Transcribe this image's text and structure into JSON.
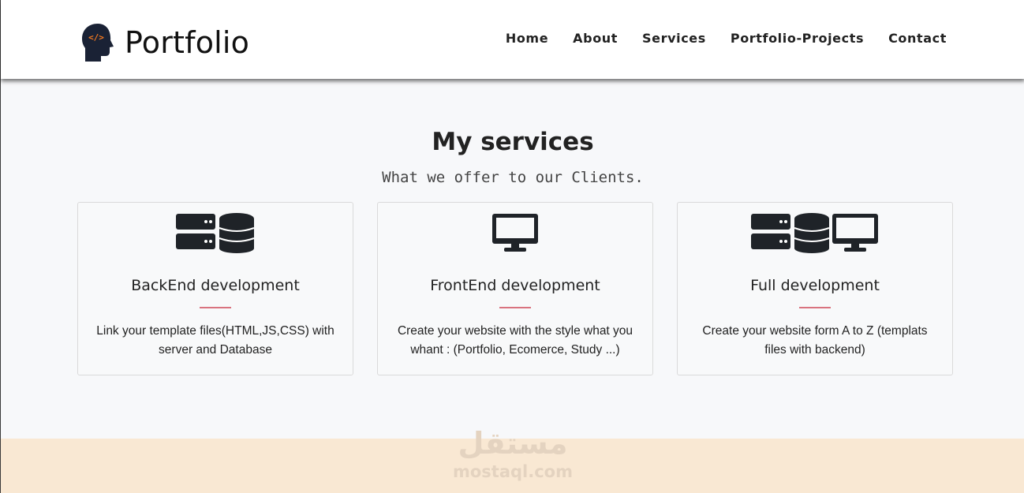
{
  "header": {
    "logo_icon": "head-code-icon",
    "title": "Portfolio",
    "nav": [
      "Home",
      "About",
      "Services",
      "Portfolio-Projects",
      "Contact"
    ]
  },
  "services": {
    "title": "My services",
    "subtitle": "What we offer to our Clients.",
    "cards": [
      {
        "icon": "server-database-icon",
        "title": "BackEnd development",
        "text": "Link your template files(HTML,JS,CSS) with server and Database"
      },
      {
        "icon": "desktop-icon",
        "title": "FrontEnd development",
        "text": "Create your website with the style what you whant : (Portfolio, Ecomerce, Study ...)"
      },
      {
        "icon": "server-database-desktop-icon",
        "title": "Full development",
        "text": "Create your website form A to Z (templats files with backend)"
      }
    ]
  },
  "watermark": {
    "arabic": "مستقل",
    "latin": "mostaql.com"
  },
  "colors": {
    "accent_rule": "#d9737f",
    "icon_dark": "#1f2328",
    "band": "#f9e8d3",
    "logo_orange": "#f47a20"
  }
}
